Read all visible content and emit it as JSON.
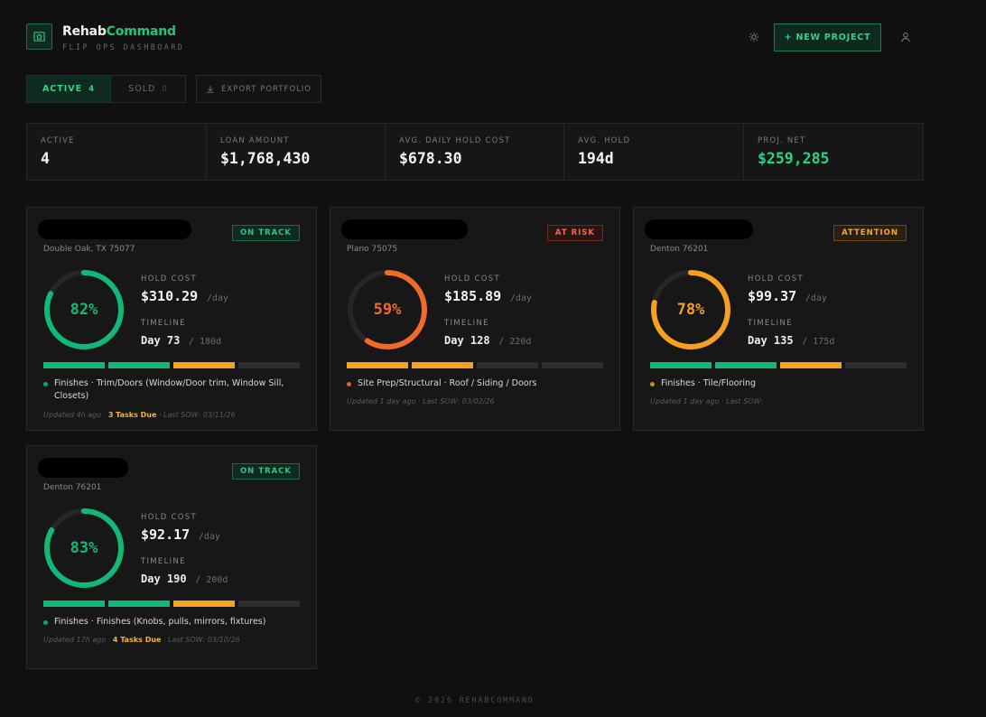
{
  "header": {
    "brand_part1": "Rehab",
    "brand_part2": "Command",
    "tagline": "FLIP OPS DASHBOARD",
    "new_project_label": "+ NEW PROJECT",
    "icons": {
      "logo": "house-dollar-icon",
      "theme": "sun-icon",
      "user": "user-icon"
    }
  },
  "tabs": {
    "active_label": "ACTIVE",
    "active_count": "4",
    "sold_label": "SOLD",
    "sold_count": "0",
    "export_label": "EXPORT PORTFOLIO"
  },
  "stats": [
    {
      "label": "ACTIVE",
      "value": "4"
    },
    {
      "label": "LOAN AMOUNT",
      "value": "$1,768,430"
    },
    {
      "label": "AVG. DAILY HOLD COST",
      "value": "$678.30"
    },
    {
      "label": "AVG. HOLD",
      "value": "194d"
    },
    {
      "label": "PROJ. NET",
      "value": "$259,285"
    }
  ],
  "colors": {
    "green": "#12b878",
    "red_orange": "#f26a2a",
    "orange": "#f6a021",
    "accent_green_text": "#2bd08a"
  },
  "projects": [
    {
      "address": "Double Oak, TX 75077",
      "status": "ON TRACK",
      "status_kind": "ontrack",
      "percent": 82,
      "percent_label": "82%",
      "hold_cost_label": "HOLD COST",
      "hold_cost": "$310.29",
      "hold_unit": "/day",
      "timeline_label": "TIMELINE",
      "day": "Day 73",
      "day_total": "/ 180d",
      "segments": [
        "g",
        "g",
        "o",
        "x"
      ],
      "phase": "Finishes · Trim/Doors (Window/Door trim, Window Sill, Closets)",
      "updated": "Updated 4h ago · ",
      "tasks_due": "3 Tasks Due",
      "last_sow": " · Last SOW: 03/11/26"
    },
    {
      "address": "Plano 75075",
      "status": "AT RISK",
      "status_kind": "atrisk",
      "percent": 59,
      "percent_label": "59%",
      "hold_cost_label": "HOLD COST",
      "hold_cost": "$185.89",
      "hold_unit": "/day",
      "timeline_label": "TIMELINE",
      "day": "Day 128",
      "day_total": "/ 220d",
      "segments": [
        "o",
        "o",
        "x",
        "x"
      ],
      "phase": "Site Prep/Structural · Roof / Siding / Doors",
      "updated": "Updated 1 day ago · Last SOW: 03/02/26",
      "tasks_due": "",
      "last_sow": ""
    },
    {
      "address": "Denton 76201",
      "status": "ATTENTION",
      "status_kind": "attention",
      "percent": 78,
      "percent_label": "78%",
      "hold_cost_label": "HOLD COST",
      "hold_cost": "$99.37",
      "hold_unit": "/day",
      "timeline_label": "TIMELINE",
      "day": "Day 135",
      "day_total": "/ 175d",
      "segments": [
        "g",
        "g",
        "o",
        "x"
      ],
      "phase": "Finishes · Tile/Flooring",
      "updated": "Updated 1 day ago · Last SOW:",
      "tasks_due": "",
      "last_sow": ""
    },
    {
      "address": "Denton 76201",
      "status": "ON TRACK",
      "status_kind": "ontrack",
      "percent": 83,
      "percent_label": "83%",
      "hold_cost_label": "HOLD COST",
      "hold_cost": "$92.17",
      "hold_unit": "/day",
      "timeline_label": "TIMELINE",
      "day": "Day 190",
      "day_total": "/ 200d",
      "segments": [
        "g",
        "g",
        "o",
        "x"
      ],
      "phase": "Finishes · Finishes (Knobs, pulls, mirrors, fixtures)",
      "updated": "Updated 17h ago · ",
      "tasks_due": "4 Tasks Due",
      "last_sow": " · Last SOW: 03/10/26"
    }
  ],
  "footer": "© 2026 REHABCOMMAND"
}
